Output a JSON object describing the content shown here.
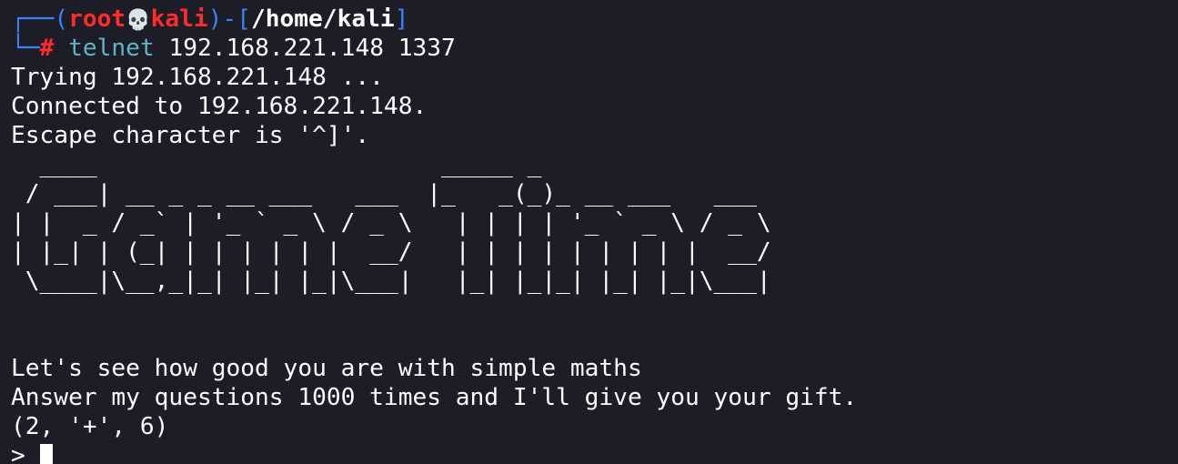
{
  "prompt": {
    "corner_top": "┌──",
    "open_paren": "(",
    "user": "root",
    "skull_glyph": "💀",
    "host": "kali",
    "close_paren": ")-[",
    "path": "/home/kali",
    "close_bracket": "]",
    "corner_bottom": "└─",
    "hash": "#",
    "command_name": "telnet",
    "command_args": " 192.168.221.148 1337"
  },
  "output": {
    "trying": "Trying 192.168.221.148 ...",
    "connected": "Connected to 192.168.221.148.",
    "escape": "Escape character is '^]'."
  },
  "banner": [
    "  ____                        _____ _",
    " / ___| __ _ _ __ ___   ___  |_   _(_)_ __ ___   ___",
    "| |  _ / _` | '_ ` _ \\ / _ \\   | | | | '_ ` _ \\ / _ \\",
    "| |_| | (_| | | | | | |  __/   | | | | | | | | |  __/",
    " \\____|\\__,_|_| |_| |_|\\___|   |_| |_|_| |_| |_|\\___|"
  ],
  "game": {
    "intro": "Let's see how good you are with simple maths",
    "instructions": "Answer my questions 1000 times and I'll give you your gift.",
    "question": "(2, '+', 6)",
    "input_prompt": "> "
  },
  "colors": {
    "background": "#1c1d26",
    "prompt_frame": "#3b82f6",
    "prompt_user": "#ff2b2b",
    "command": "#5fb4c4",
    "text": "#ffffff"
  }
}
